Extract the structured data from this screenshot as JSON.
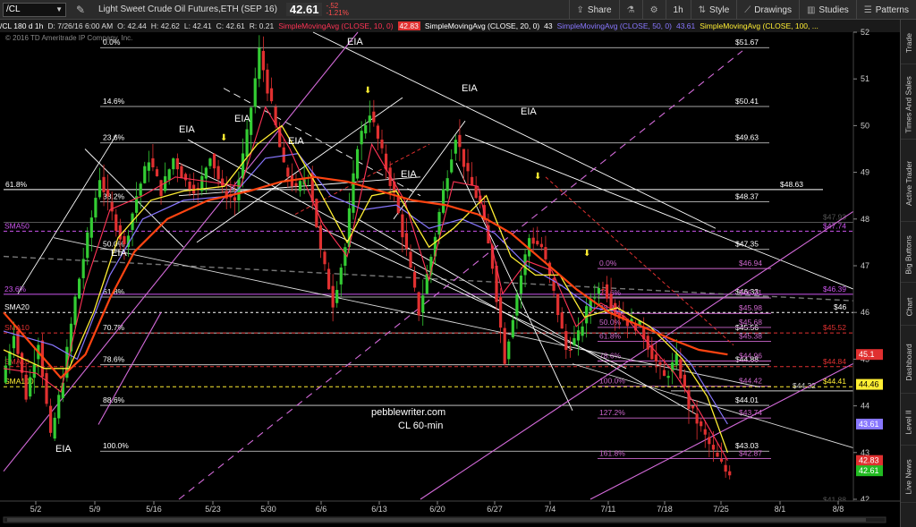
{
  "toolbar": {
    "symbol": "/CL",
    "title": "Light Sweet Crude Oil Futures,ETH (SEP 16)",
    "last_price": "42.61",
    "change": "-.52",
    "change_pct": "-1.21%",
    "share_label": "Share",
    "timeframe_label": "1h",
    "style_label": "Style",
    "drawings_label": "Drawings",
    "studies_label": "Studies",
    "patterns_label": "Patterns"
  },
  "infobar": {
    "symbol_period": "/CL 180 d 1h",
    "date": "D: 7/26/16 6:00 AM",
    "open": "O: 42.44",
    "high": "H: 42.62",
    "low": "L: 42.41",
    "close": "C: 42.61",
    "range": "R: 0.21",
    "sma10_label": "SimpleMovingAvg (CLOSE, 10, 0)",
    "sma10_value": "42.83",
    "sma20_label": "SimpleMovingAvg (CLOSE, 20, 0)",
    "sma20_value": "43",
    "sma50_label": "SimpleMovingAvg (CLOSE, 50, 0)",
    "sma50_value": "43.61",
    "sma100_label": "SimpleMovingAvg (CLOSE, 100, ..."
  },
  "copyright": "© 2016 TD Ameritrade IP Company, Inc.",
  "sidebar_tabs": [
    "Trade",
    "Times And Sales",
    "Active Trader",
    "Big Buttons",
    "Chart",
    "Dashboard",
    "Level II",
    "Live News"
  ],
  "colors": {
    "price_up": "#33cc33",
    "price_down": "#e03030",
    "sma10": "#ff3355",
    "sma20": "#ffee33",
    "sma50": "#8877ff",
    "sma100": "#ff4411",
    "fib_magenta": "#cc66cc",
    "trend_white": "#ffffff"
  },
  "chart_data": {
    "type": "candlestick",
    "xlabels": [
      "5/2",
      "5/9",
      "5/16",
      "5/23",
      "5/30",
      "6/6",
      "6/13",
      "6/20",
      "6/27",
      "7/4",
      "7/11",
      "7/18",
      "7/25",
      "8/1",
      "8/8"
    ],
    "ylim": [
      42,
      52
    ],
    "yticks": [
      42,
      43,
      44,
      45,
      46,
      47,
      48,
      49,
      50,
      51,
      52
    ],
    "watermark": [
      "pebblewriter.com",
      "CL 60-min"
    ],
    "eia_labels": [
      "EIA",
      "EIA",
      "EIA",
      "EIA",
      "EIA",
      "EIA",
      "EIA",
      "EIA",
      "EIA",
      "EIA"
    ],
    "fib_left": [
      {
        "label": "0.0%",
        "value": 51.67,
        "price": "$51.67"
      },
      {
        "label": "14.6%",
        "value": 50.41,
        "price": "$50.41"
      },
      {
        "label": "23.6%",
        "value": 49.63,
        "price": "$49.63"
      },
      {
        "label": "38.2%",
        "value": 48.37,
        "price": "$48.37"
      },
      {
        "label": "50.0%",
        "value": 47.35,
        "price": "$47.35"
      },
      {
        "label": "61.8%",
        "value": 46.33,
        "price": "$46.33"
      },
      {
        "label": "70.7%",
        "value": 45.56,
        "price": "$45.56"
      },
      {
        "label": "78.6%",
        "value": 44.88,
        "price": "$44.88"
      },
      {
        "label": "88.6%",
        "value": 44.01,
        "price": "$44.01"
      },
      {
        "label": "100.0%",
        "value": 43.03,
        "price": "$43.03"
      }
    ],
    "fib_right": [
      {
        "label": "0.0%",
        "value": 46.94,
        "price": "$46.94"
      },
      {
        "label": "23.6%",
        "value": 46.31,
        "price": "$46.31"
      },
      {
        "label": "38.2%",
        "value": 45.98,
        "price": "$45.98"
      },
      {
        "label": "50.0%",
        "value": 45.68,
        "price": "$45.68"
      },
      {
        "label": "61.8%",
        "value": 45.38,
        "price": "$45.38"
      },
      {
        "label": "78.6%",
        "value": 44.96,
        "price": "$44.96"
      },
      {
        "label": "100.0%",
        "value": 44.42,
        "price": "$44.42"
      },
      {
        "label": "127.2%",
        "value": 43.74,
        "price": "$43.74"
      },
      {
        "label": "161.8%",
        "value": 42.87,
        "price": "$42.87"
      }
    ],
    "other_levels": [
      {
        "label": "61.8%",
        "value": 48.63,
        "price": "$48.63"
      },
      {
        "label": "",
        "value": 47.93,
        "price": "$47.93"
      },
      {
        "label": "SMA50",
        "value": 47.74,
        "price": "$47.74"
      },
      {
        "label": "23.6%",
        "value": 46.39,
        "price": "$46.39"
      },
      {
        "label": "SMA20",
        "value": 46,
        "price": "$46"
      },
      {
        "label": "SMA10",
        "value": 45.56,
        "price": "$45.52"
      },
      {
        "label": "SMA10",
        "value": 44.84,
        "price": "$44.84"
      },
      {
        "label": "SMA100",
        "value": 44.41,
        "price": "$44.41"
      },
      {
        "label": "",
        "value": 44.32,
        "price": "$44.32"
      },
      {
        "label": "",
        "value": 41.88,
        "price": "$41.88"
      }
    ],
    "price_tags": [
      {
        "value": 45.1,
        "label": "45.1",
        "color": "#e03030"
      },
      {
        "value": 44.46,
        "label": "44.46",
        "color": "#ffee33"
      },
      {
        "value": 43.61,
        "label": "43.61",
        "color": "#8877ff"
      },
      {
        "value": 42.83,
        "label": "42.83",
        "color": "#e03030"
      },
      {
        "value": 42.61,
        "label": "42.61",
        "color": "#22bb22"
      }
    ],
    "price_path": [
      [
        0,
        44.5
      ],
      [
        3,
        45.6
      ],
      [
        6,
        44.2
      ],
      [
        9,
        45.4
      ],
      [
        12,
        43.3
      ],
      [
        15,
        44.6
      ],
      [
        18,
        46.3
      ],
      [
        21,
        47.6
      ],
      [
        24,
        48.9
      ],
      [
        27,
        48.1
      ],
      [
        30,
        47.4
      ],
      [
        33,
        48.5
      ],
      [
        36,
        49.3
      ],
      [
        39,
        48.6
      ],
      [
        42,
        49.3
      ],
      [
        45,
        48.8
      ],
      [
        48,
        48.6
      ],
      [
        51,
        49.4
      ],
      [
        54,
        48.6
      ],
      [
        57,
        48.4
      ],
      [
        60,
        49.8
      ],
      [
        63,
        51.6
      ],
      [
        66,
        50.4
      ],
      [
        69,
        49.1
      ],
      [
        72,
        48.6
      ],
      [
        75,
        49.0
      ],
      [
        78,
        47.3
      ],
      [
        81,
        46.2
      ],
      [
        84,
        47.4
      ],
      [
        87,
        49.6
      ],
      [
        90,
        50.3
      ],
      [
        93,
        49.4
      ],
      [
        96,
        48.5
      ],
      [
        99,
        47.3
      ],
      [
        102,
        46.0
      ],
      [
        105,
        47.2
      ],
      [
        108,
        48.6
      ],
      [
        111,
        49.8
      ],
      [
        114,
        48.9
      ],
      [
        117,
        48.3
      ],
      [
        120,
        47.0
      ],
      [
        123,
        45.0
      ],
      [
        126,
        46.4
      ],
      [
        129,
        47.6
      ],
      [
        132,
        47.4
      ],
      [
        135,
        46.4
      ],
      [
        138,
        45.2
      ],
      [
        141,
        45.5
      ],
      [
        144,
        46.3
      ],
      [
        147,
        46.6
      ],
      [
        150,
        46.0
      ],
      [
        153,
        45.8
      ],
      [
        156,
        45.7
      ],
      [
        159,
        45.1
      ],
      [
        162,
        44.6
      ],
      [
        165,
        45.0
      ],
      [
        168,
        44.0
      ],
      [
        171,
        43.5
      ],
      [
        174,
        43.0
      ],
      [
        177,
        42.6
      ]
    ],
    "sma10": [
      [
        0,
        44.8
      ],
      [
        8,
        44.7
      ],
      [
        14,
        44.3
      ],
      [
        20,
        46.6
      ],
      [
        26,
        48.2
      ],
      [
        34,
        48.5
      ],
      [
        42,
        48.9
      ],
      [
        50,
        48.8
      ],
      [
        58,
        48.7
      ],
      [
        64,
        50.4
      ],
      [
        70,
        49.5
      ],
      [
        78,
        47.9
      ],
      [
        84,
        47.2
      ],
      [
        90,
        49.6
      ],
      [
        98,
        48.4
      ],
      [
        104,
        46.7
      ],
      [
        110,
        48.8
      ],
      [
        116,
        48.7
      ],
      [
        122,
        46.4
      ],
      [
        128,
        47.1
      ],
      [
        134,
        46.9
      ],
      [
        140,
        45.7
      ],
      [
        146,
        46.2
      ],
      [
        152,
        45.9
      ],
      [
        158,
        45.3
      ],
      [
        164,
        44.7
      ],
      [
        170,
        43.9
      ],
      [
        177,
        42.83
      ]
    ],
    "sma20": [
      [
        0,
        45.2
      ],
      [
        10,
        44.8
      ],
      [
        16,
        44.8
      ],
      [
        22,
        46.0
      ],
      [
        28,
        47.6
      ],
      [
        36,
        48.4
      ],
      [
        44,
        48.6
      ],
      [
        54,
        48.7
      ],
      [
        62,
        49.6
      ],
      [
        68,
        50.0
      ],
      [
        76,
        48.8
      ],
      [
        84,
        47.5
      ],
      [
        90,
        48.5
      ],
      [
        96,
        48.6
      ],
      [
        104,
        47.4
      ],
      [
        110,
        47.8
      ],
      [
        118,
        48.5
      ],
      [
        124,
        47.2
      ],
      [
        130,
        46.8
      ],
      [
        136,
        46.8
      ],
      [
        142,
        45.9
      ],
      [
        150,
        46.1
      ],
      [
        158,
        45.7
      ],
      [
        166,
        45.0
      ],
      [
        172,
        44.2
      ],
      [
        177,
        43.0
      ]
    ],
    "sma50": [
      [
        0,
        45.6
      ],
      [
        12,
        45.3
      ],
      [
        18,
        45.0
      ],
      [
        26,
        46.8
      ],
      [
        34,
        48.0
      ],
      [
        44,
        48.4
      ],
      [
        56,
        48.5
      ],
      [
        64,
        49.3
      ],
      [
        72,
        49.4
      ],
      [
        80,
        48.5
      ],
      [
        88,
        48.2
      ],
      [
        96,
        48.3
      ],
      [
        104,
        47.8
      ],
      [
        112,
        48.0
      ],
      [
        120,
        47.7
      ],
      [
        128,
        47.0
      ],
      [
        136,
        46.6
      ],
      [
        144,
        46.1
      ],
      [
        152,
        46.0
      ],
      [
        160,
        45.6
      ],
      [
        168,
        44.9
      ],
      [
        177,
        43.61
      ]
    ],
    "sma100": [
      [
        0,
        46.0
      ],
      [
        8,
        45.2
      ],
      [
        14,
        44.6
      ],
      [
        20,
        45.1
      ],
      [
        26,
        46.3
      ],
      [
        32,
        47.3
      ],
      [
        40,
        48.0
      ],
      [
        50,
        48.4
      ],
      [
        60,
        48.6
      ],
      [
        68,
        48.8
      ],
      [
        76,
        48.9
      ],
      [
        84,
        48.8
      ],
      [
        92,
        48.6
      ],
      [
        100,
        48.4
      ],
      [
        108,
        48.3
      ],
      [
        116,
        48.1
      ],
      [
        124,
        47.7
      ],
      [
        132,
        47.1
      ],
      [
        140,
        46.5
      ],
      [
        148,
        46.0
      ],
      [
        156,
        45.7
      ],
      [
        164,
        45.4
      ],
      [
        170,
        45.2
      ],
      [
        177,
        45.1
      ]
    ]
  }
}
